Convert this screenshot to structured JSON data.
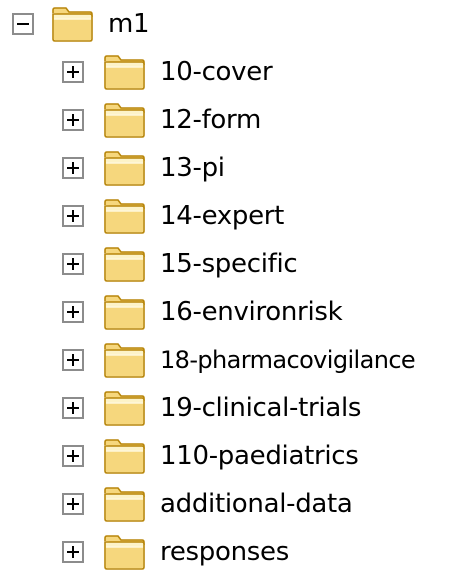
{
  "tree": {
    "root": {
      "label": "m1",
      "expanded": true,
      "expander": "minus",
      "icon": "folder-icon"
    },
    "children": [
      {
        "label": "10-cover",
        "expander": "plus",
        "icon": "folder-icon"
      },
      {
        "label": "12-form",
        "expander": "plus",
        "icon": "folder-icon"
      },
      {
        "label": "13-pi",
        "expander": "plus",
        "icon": "folder-icon"
      },
      {
        "label": "14-expert",
        "expander": "plus",
        "icon": "folder-icon"
      },
      {
        "label": "15-specific",
        "expander": "plus",
        "icon": "folder-icon"
      },
      {
        "label": "16-environrisk",
        "expander": "plus",
        "icon": "folder-icon"
      },
      {
        "label": "18-pharmacovigilance",
        "expander": "plus",
        "icon": "folder-icon"
      },
      {
        "label": "19-clinical-trials",
        "expander": "plus",
        "icon": "folder-icon"
      },
      {
        "label": "110-paediatrics",
        "expander": "plus",
        "icon": "folder-icon"
      },
      {
        "label": "additional-data",
        "expander": "plus",
        "icon": "folder-icon"
      },
      {
        "label": "responses",
        "expander": "plus",
        "icon": "folder-icon"
      }
    ]
  },
  "colors": {
    "folder_fill": "#f6d77d",
    "folder_light": "#fdf3c8",
    "folder_outline": "#b8860b",
    "expander_border": "#8c8c8c",
    "background": "#ffffff"
  }
}
